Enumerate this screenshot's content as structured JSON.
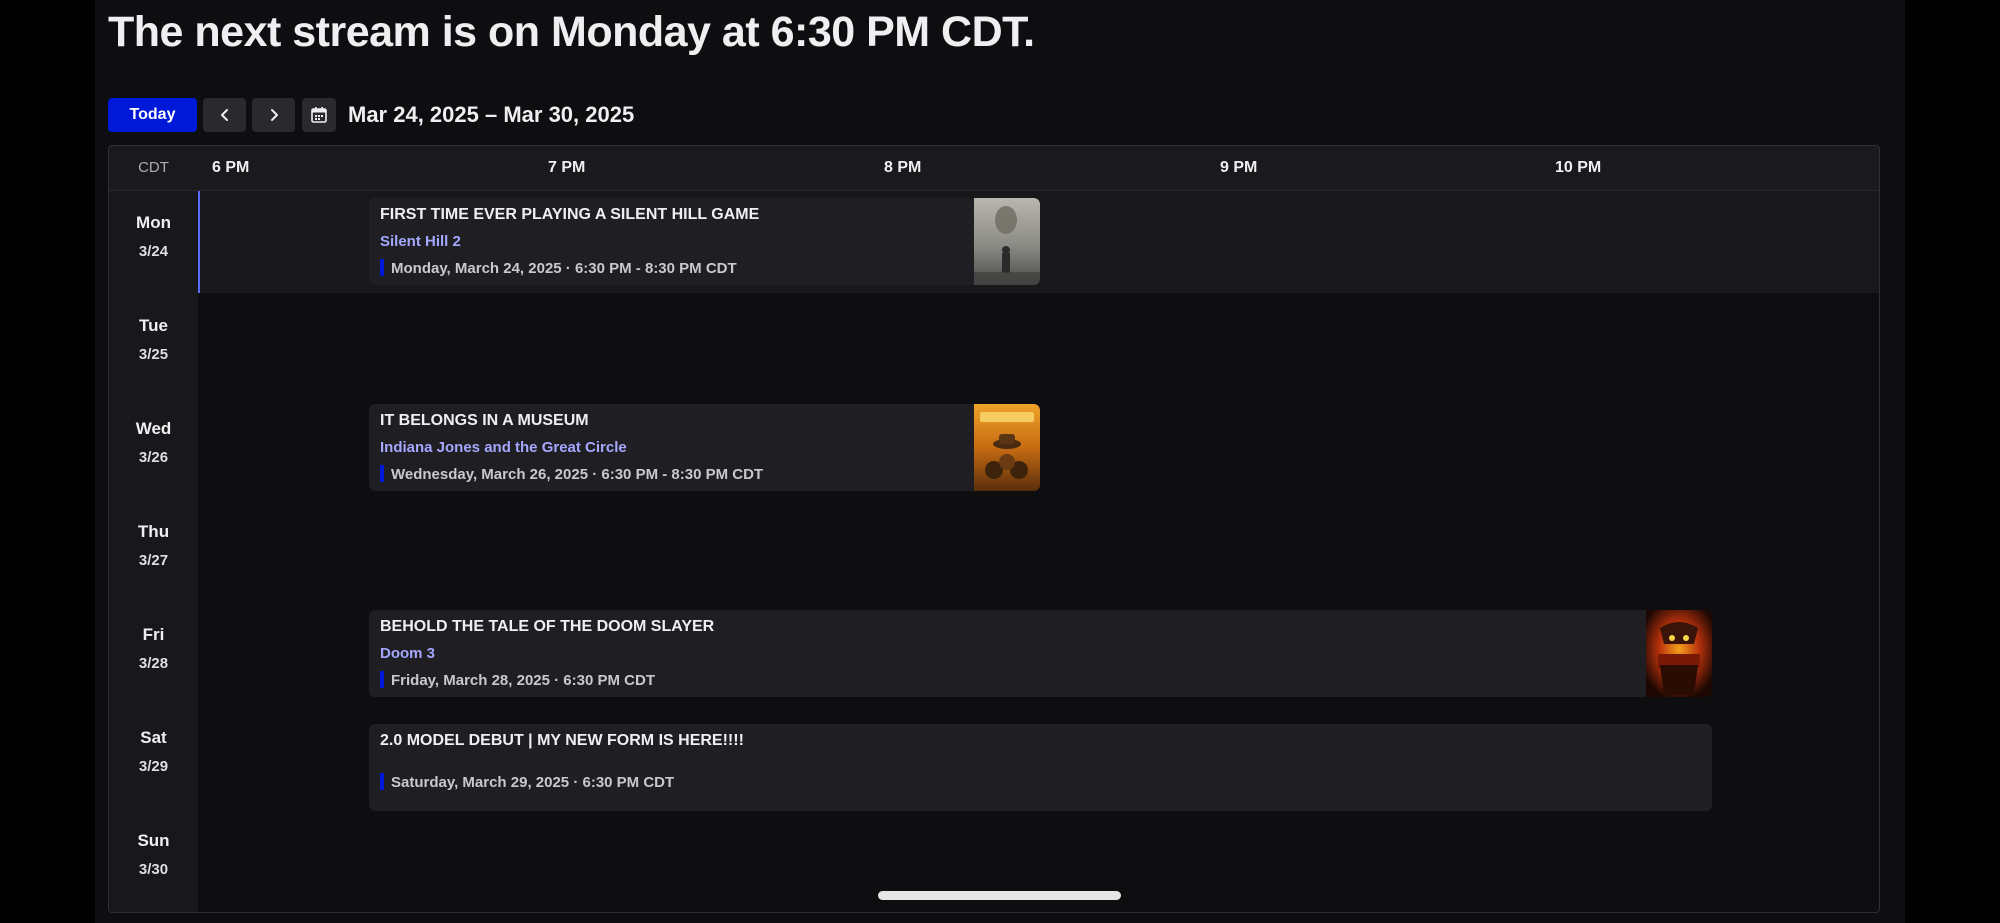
{
  "headline": "The next stream is on Monday at 6:30 PM CDT.",
  "toolbar": {
    "today_label": "Today",
    "prev_icon": "chevron-left-icon",
    "next_icon": "chevron-right-icon",
    "calendar_icon": "calendar-icon",
    "date_range": "Mar 24, 2025 – Mar 30, 2025"
  },
  "calendar": {
    "timezone": "CDT",
    "hours": [
      "6 PM",
      "7 PM",
      "8 PM",
      "9 PM",
      "10 PM"
    ],
    "days": [
      {
        "name": "Mon",
        "date": "3/24"
      },
      {
        "name": "Tue",
        "date": "3/25"
      },
      {
        "name": "Wed",
        "date": "3/26"
      },
      {
        "name": "Thu",
        "date": "3/27"
      },
      {
        "name": "Fri",
        "date": "3/28"
      },
      {
        "name": "Sat",
        "date": "3/29"
      },
      {
        "name": "Sun",
        "date": "3/30"
      }
    ],
    "events": [
      {
        "title": "FIRST TIME EVER PLAYING A SILENT HILL GAME",
        "game": "Silent Hill 2",
        "time": "Monday, March 24, 2025 · 6:30 PM - 8:30 PM CDT",
        "thumbnail": "silent-hill-2-box-art"
      },
      {
        "title": "IT BELONGS IN A MUSEUM",
        "game": "Indiana Jones and the Great Circle",
        "time": "Wednesday, March 26, 2025 · 6:30 PM - 8:30 PM CDT",
        "thumbnail": "indiana-jones-box-art"
      },
      {
        "title": "BEHOLD THE TALE OF THE DOOM SLAYER",
        "game": "Doom 3",
        "time": "Friday, March 28, 2025 · 6:30 PM CDT",
        "thumbnail": "doom-3-box-art"
      },
      {
        "title": "2.0 MODEL DEBUT | MY NEW FORM IS HERE!!!!",
        "time": "Saturday, March 29, 2025 · 6:30 PM CDT"
      }
    ]
  },
  "colors": {
    "accent": "#0019d8",
    "game_link": "#a5a7ff",
    "today_marker": "#5c6bff",
    "background": "#0e0e10"
  }
}
